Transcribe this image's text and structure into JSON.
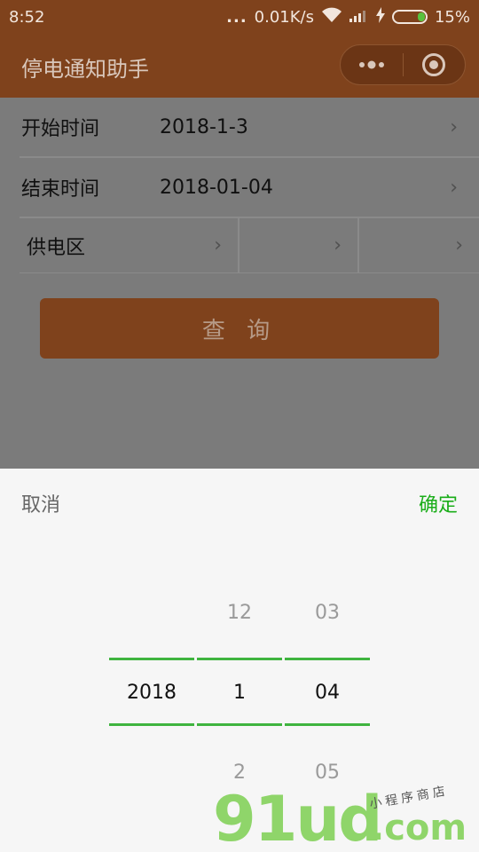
{
  "status_bar": {
    "time": "8:52",
    "dots": "...",
    "network_speed": "0.01K/s",
    "battery": "15%",
    "battery_fill_fraction": 0.15,
    "battery_color": "#59c23e"
  },
  "nav": {
    "title": "停电通知助手",
    "menu_icon": "more-dots-icon",
    "close_icon": "target-icon",
    "color": "#7f421c"
  },
  "form": {
    "start": {
      "label": "开始时间",
      "value": "2018-1-3"
    },
    "end": {
      "label": "结束时间",
      "value": "2018-01-04"
    },
    "area": {
      "label": "供电区",
      "value2": "",
      "value3": ""
    },
    "chevron": "›"
  },
  "query_button": "查 询",
  "picker": {
    "cancel": "取消",
    "confirm": "确定",
    "confirm_color": "#1aad19",
    "year": {
      "selected": "2018"
    },
    "month": {
      "prev": "12",
      "selected": "1",
      "next": "2"
    },
    "day": {
      "prev": "03",
      "selected": "04",
      "next": "05"
    }
  },
  "watermark": {
    "main": "91ud",
    "suffix": ".com",
    "tag": "小程序商店"
  }
}
